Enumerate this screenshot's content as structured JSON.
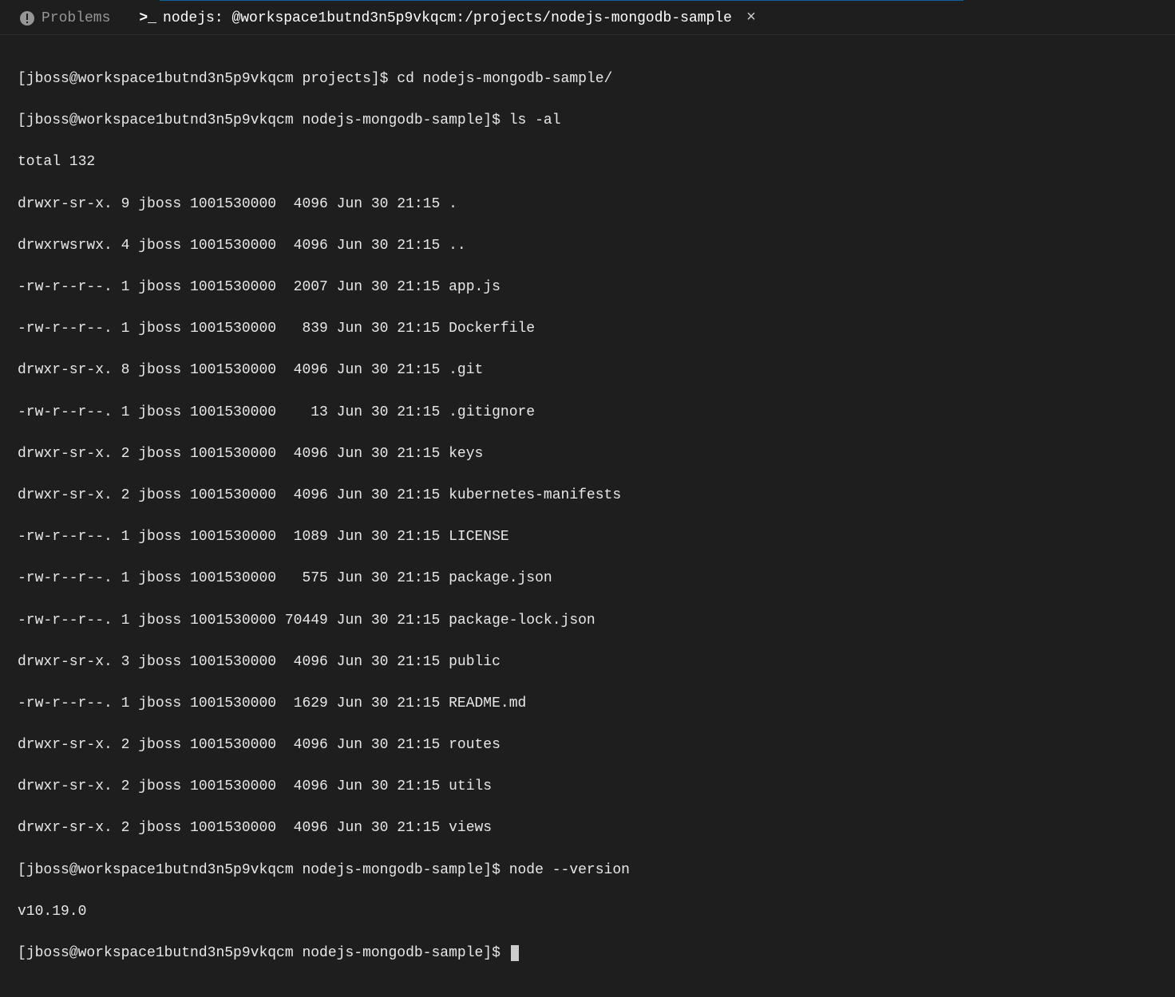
{
  "tabs": {
    "problems": {
      "label": "Problems",
      "icon": "warning-icon"
    },
    "terminal": {
      "icon_prefix": ">_",
      "label": "nodejs: @workspace1butnd3n5p9vkqcm:/projects/nodejs-mongodb-sample",
      "close": "×"
    }
  },
  "terminal": {
    "lines": [
      "[jboss@workspace1butnd3n5p9vkqcm projects]$ cd nodejs-mongodb-sample/",
      "[jboss@workspace1butnd3n5p9vkqcm nodejs-mongodb-sample]$ ls -al",
      "total 132",
      "drwxr-sr-x. 9 jboss 1001530000  4096 Jun 30 21:15 .",
      "drwxrwsrwx. 4 jboss 1001530000  4096 Jun 30 21:15 ..",
      "-rw-r--r--. 1 jboss 1001530000  2007 Jun 30 21:15 app.js",
      "-rw-r--r--. 1 jboss 1001530000   839 Jun 30 21:15 Dockerfile",
      "drwxr-sr-x. 8 jboss 1001530000  4096 Jun 30 21:15 .git",
      "-rw-r--r--. 1 jboss 1001530000    13 Jun 30 21:15 .gitignore",
      "drwxr-sr-x. 2 jboss 1001530000  4096 Jun 30 21:15 keys",
      "drwxr-sr-x. 2 jboss 1001530000  4096 Jun 30 21:15 kubernetes-manifests",
      "-rw-r--r--. 1 jboss 1001530000  1089 Jun 30 21:15 LICENSE",
      "-rw-r--r--. 1 jboss 1001530000   575 Jun 30 21:15 package.json",
      "-rw-r--r--. 1 jboss 1001530000 70449 Jun 30 21:15 package-lock.json",
      "drwxr-sr-x. 3 jboss 1001530000  4096 Jun 30 21:15 public",
      "-rw-r--r--. 1 jboss 1001530000  1629 Jun 30 21:15 README.md",
      "drwxr-sr-x. 2 jboss 1001530000  4096 Jun 30 21:15 routes",
      "drwxr-sr-x. 2 jboss 1001530000  4096 Jun 30 21:15 utils",
      "drwxr-sr-x. 2 jboss 1001530000  4096 Jun 30 21:15 views",
      "[jboss@workspace1butnd3n5p9vkqcm nodejs-mongodb-sample]$ node --version",
      "v10.19.0",
      "[jboss@workspace1butnd3n5p9vkqcm nodejs-mongodb-sample]$ "
    ]
  }
}
